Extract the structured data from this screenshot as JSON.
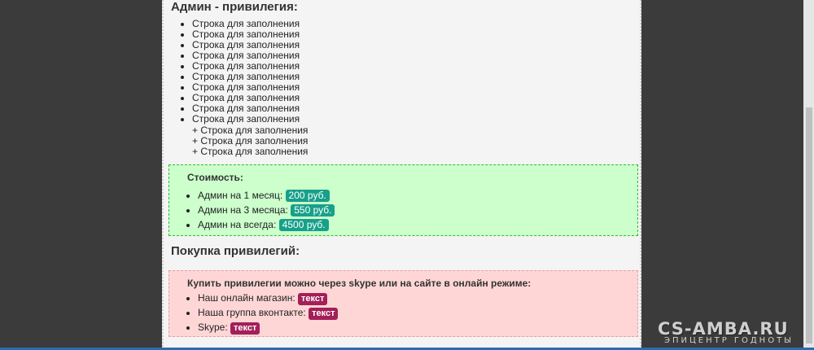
{
  "admin": {
    "title": "Админ - привилегия:",
    "items": [
      "Строка для заполнения",
      "Строка для заполнения",
      "Строка для заполнения",
      "Строка для заполнения",
      "Строка для заполнения",
      "Строка для заполнения",
      "Строка для заполнения",
      "Строка для заполнения",
      "Строка для заполнения",
      "Строка для заполнения"
    ],
    "plus_items": [
      "+ Строка для заполнения",
      "+ Строка для заполнения",
      "+ Строка для заполнения"
    ]
  },
  "price": {
    "title": "Стоимость:",
    "items": [
      {
        "label": "Админ на 1 месяц:",
        "price": "200 руб."
      },
      {
        "label": "Админ на 3 месяца:",
        "price": "550 руб."
      },
      {
        "label": "Админ на всегда:",
        "price": "4500 руб."
      }
    ]
  },
  "purchase": {
    "title": "Покупка привилегий:",
    "box_title": "Купить привилегии можно через skype или на сайте в онлайн режиме:",
    "items": [
      {
        "label": "Наш онлайн магазин:",
        "tag": "текст"
      },
      {
        "label": "Наша группа вконтакте:",
        "tag": "текст"
      },
      {
        "label": "Skype:",
        "tag": "текст"
      }
    ]
  },
  "watermark": {
    "brand": "CS-AMBA.RU",
    "tagline": "ЭПИЦЕНТР ГОДНОТЫ"
  },
  "colors": {
    "price_tag": "#17a08a",
    "contact_tag": "#a31f58",
    "green_box": "#ccffcc",
    "red_box": "#ffd6d6"
  }
}
